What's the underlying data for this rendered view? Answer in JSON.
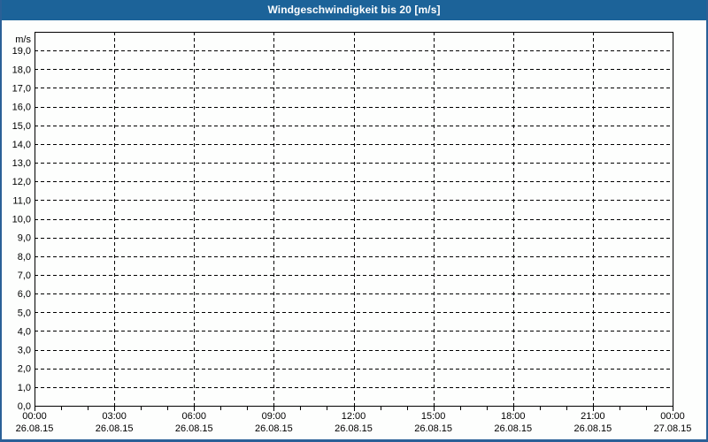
{
  "window": {
    "title": "Windgeschwindigkeit bis 20 [m/s]"
  },
  "colors": {
    "titlebar_bg": "#1c6399",
    "titlebar_text": "#ffffff",
    "frame_border": "#2a6097",
    "background": "#fdfefd",
    "plot_border": "#000000",
    "grid": "#000000",
    "axis_text": "#000000"
  },
  "chart_data": {
    "type": "line",
    "title": "Windgeschwindigkeit bis 20 [m/s]",
    "ylabel": "m/s",
    "ylim": [
      0,
      20
    ],
    "y_tick_step": 1,
    "y_tick_labels": [
      "0,0",
      "1,0",
      "2,0",
      "3,0",
      "4,0",
      "5,0",
      "6,0",
      "7,0",
      "8,0",
      "9,0",
      "10,0",
      "11,0",
      "12,0",
      "13,0",
      "14,0",
      "15,0",
      "16,0",
      "17,0",
      "18,0",
      "19,0"
    ],
    "y_unit_label": "m/s",
    "hours_span": 24,
    "major_interval_hours": 3,
    "minor_interval_hours": 1,
    "grid": true,
    "grid_style": "dashed",
    "legend": null,
    "x_ticks": [
      {
        "time": "00:00",
        "date": "26.08.15"
      },
      {
        "time": "03:00",
        "date": "26.08.15"
      },
      {
        "time": "06:00",
        "date": "26.08.15"
      },
      {
        "time": "09:00",
        "date": "26.08.15"
      },
      {
        "time": "12:00",
        "date": "26.08.15"
      },
      {
        "time": "15:00",
        "date": "26.08.15"
      },
      {
        "time": "18:00",
        "date": "26.08.15"
      },
      {
        "time": "21:00",
        "date": "26.08.15"
      },
      {
        "time": "00:00",
        "date": "27.08.15"
      }
    ],
    "series": []
  }
}
